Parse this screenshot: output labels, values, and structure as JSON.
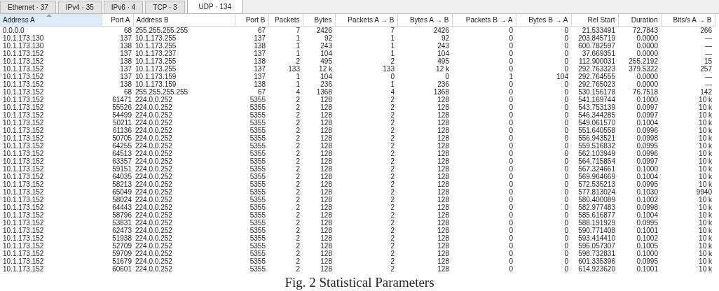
{
  "tabs": [
    {
      "label": "Ethernet · 37",
      "selected": false
    },
    {
      "label": "IPv4 · 35",
      "selected": false
    },
    {
      "label": "IPv6 · 4",
      "selected": false
    },
    {
      "label": "TCP · 3",
      "selected": false
    },
    {
      "label": "UDP · 134",
      "selected": true
    }
  ],
  "table": {
    "columns": [
      {
        "label": "Address A",
        "sorted": true
      },
      {
        "label": "Port A",
        "sorted": false
      },
      {
        "label": "Address B",
        "sorted": false
      },
      {
        "label": "Port B",
        "sorted": false
      },
      {
        "label": "Packets",
        "sorted": false
      },
      {
        "label": "Bytes",
        "sorted": false
      },
      {
        "label": "Packets A → B",
        "sorted": false
      },
      {
        "label": "Bytes A → B",
        "sorted": false
      },
      {
        "label": "Packets B → A",
        "sorted": false
      },
      {
        "label": "Bytes B → A",
        "sorted": false
      },
      {
        "label": "Rel Start",
        "sorted": false
      },
      {
        "label": "Duration",
        "sorted": false
      },
      {
        "label": "Bits/s A → B",
        "sorted": false
      }
    ],
    "rows": [
      [
        "0.0.0.0",
        "68",
        "255.255.255.255",
        "67",
        "7",
        "2426",
        "7",
        "2426",
        "0",
        "0",
        "21.533491",
        "72.7843",
        "266"
      ],
      [
        "10.1.173.130",
        "137",
        "10.1.173.255",
        "137",
        "1",
        "92",
        "1",
        "92",
        "0",
        "0",
        "203.845719",
        "0.0000",
        "—"
      ],
      [
        "10.1.173.130",
        "138",
        "10.1.173.255",
        "138",
        "1",
        "243",
        "1",
        "243",
        "0",
        "0",
        "600.782597",
        "0.0000",
        "—"
      ],
      [
        "10.1.173.152",
        "137",
        "10.1.173.237",
        "137",
        "1",
        "104",
        "1",
        "104",
        "0",
        "0",
        "37.669351",
        "0.0000",
        "—"
      ],
      [
        "10.1.173.152",
        "138",
        "10.1.173.255",
        "138",
        "2",
        "495",
        "2",
        "495",
        "0",
        "0",
        "112.900031",
        "255.2192",
        "15"
      ],
      [
        "10.1.173.152",
        "137",
        "10.1.173.255",
        "137",
        "133",
        "12 k",
        "133",
        "12 k",
        "0",
        "0",
        "292.763323",
        "379.5322",
        "257"
      ],
      [
        "10.1.173.152",
        "137",
        "10.1.173.159",
        "137",
        "1",
        "104",
        "0",
        "0",
        "1",
        "104",
        "292.764555",
        "0.0000",
        "—"
      ],
      [
        "10.1.173.152",
        "138",
        "10.1.173.159",
        "138",
        "1",
        "236",
        "1",
        "236",
        "0",
        "0",
        "292.765023",
        "0.0000",
        "—"
      ],
      [
        "10.1.173.152",
        "68",
        "255.255.255.255",
        "67",
        "4",
        "1368",
        "4",
        "1368",
        "0",
        "0",
        "530.156178",
        "76.7518",
        "142"
      ],
      [
        "10.1.173.152",
        "61471",
        "224.0.0.252",
        "5355",
        "2",
        "128",
        "2",
        "128",
        "0",
        "0",
        "541.169744",
        "0.1000",
        "10 k"
      ],
      [
        "10.1.173.152",
        "55526",
        "224.0.0.252",
        "5355",
        "2",
        "128",
        "2",
        "128",
        "0",
        "0",
        "543.753139",
        "0.0997",
        "10 k"
      ],
      [
        "10.1.173.152",
        "54499",
        "224.0.0.252",
        "5355",
        "2",
        "128",
        "2",
        "128",
        "0",
        "0",
        "546.344285",
        "0.0997",
        "10 k"
      ],
      [
        "10.1.173.152",
        "50211",
        "224.0.0.252",
        "5355",
        "2",
        "128",
        "2",
        "128",
        "0",
        "0",
        "549.061570",
        "0.1004",
        "10 k"
      ],
      [
        "10.1.173.152",
        "61136",
        "224.0.0.252",
        "5355",
        "2",
        "128",
        "2",
        "128",
        "0",
        "0",
        "551.640558",
        "0.0996",
        "10 k"
      ],
      [
        "10.1.173.152",
        "50705",
        "224.0.0.252",
        "5355",
        "2",
        "128",
        "2",
        "128",
        "0",
        "0",
        "556.943521",
        "0.0998",
        "10 k"
      ],
      [
        "10.1.173.152",
        "64255",
        "224.0.0.252",
        "5355",
        "2",
        "128",
        "2",
        "128",
        "0",
        "0",
        "559.516832",
        "0.0995",
        "10 k"
      ],
      [
        "10.1.173.152",
        "64513",
        "224.0.0.252",
        "5355",
        "2",
        "128",
        "2",
        "128",
        "0",
        "0",
        "562.103949",
        "0.0996",
        "10 k"
      ],
      [
        "10.1.173.152",
        "63357",
        "224.0.0.252",
        "5355",
        "2",
        "128",
        "2",
        "128",
        "0",
        "0",
        "564.715854",
        "0.0997",
        "10 k"
      ],
      [
        "10.1.173.152",
        "59151",
        "224.0.0.252",
        "5355",
        "2",
        "128",
        "2",
        "128",
        "0",
        "0",
        "567.324661",
        "0.1000",
        "10 k"
      ],
      [
        "10.1.173.152",
        "64035",
        "224.0.0.252",
        "5355",
        "2",
        "128",
        "2",
        "128",
        "0",
        "0",
        "569.964669",
        "0.1004",
        "10 k"
      ],
      [
        "10.1.173.152",
        "58213",
        "224.0.0.252",
        "5355",
        "2",
        "128",
        "2",
        "128",
        "0",
        "0",
        "572.535213",
        "0.0995",
        "10 k"
      ],
      [
        "10.1.173.152",
        "65049",
        "224.0.0.252",
        "5355",
        "2",
        "128",
        "2",
        "128",
        "0",
        "0",
        "577.813024",
        "0.1030",
        "9940"
      ],
      [
        "10.1.173.152",
        "58024",
        "224.0.0.252",
        "5355",
        "2",
        "128",
        "2",
        "128",
        "0",
        "0",
        "580.400089",
        "0.1002",
        "10 k"
      ],
      [
        "10.1.173.152",
        "64443",
        "224.0.0.252",
        "5355",
        "2",
        "128",
        "2",
        "128",
        "0",
        "0",
        "582.977483",
        "0.0998",
        "10 k"
      ],
      [
        "10.1.173.152",
        "58796",
        "224.0.0.252",
        "5355",
        "2",
        "128",
        "2",
        "128",
        "0",
        "0",
        "585.616877",
        "0.1004",
        "10 k"
      ],
      [
        "10.1.173.152",
        "53831",
        "224.0.0.252",
        "5355",
        "2",
        "128",
        "2",
        "128",
        "0",
        "0",
        "588.191929",
        "0.0995",
        "10 k"
      ],
      [
        "10.1.173.152",
        "62473",
        "224.0.0.252",
        "5355",
        "2",
        "128",
        "2",
        "128",
        "0",
        "0",
        "590.771408",
        "0.1001",
        "10 k"
      ],
      [
        "10.1.173.152",
        "51938",
        "224.0.0.252",
        "5355",
        "2",
        "128",
        "2",
        "128",
        "0",
        "0",
        "593.414410",
        "0.1002",
        "10 k"
      ],
      [
        "10.1.173.152",
        "52709",
        "224.0.0.252",
        "5355",
        "2",
        "128",
        "2",
        "128",
        "0",
        "0",
        "596.057307",
        "0.1005",
        "10 k"
      ],
      [
        "10.1.173.152",
        "59709",
        "224.0.0.252",
        "5355",
        "2",
        "128",
        "2",
        "128",
        "0",
        "0",
        "598.732831",
        "0.1000",
        "10 k"
      ],
      [
        "10.1.173.152",
        "51679",
        "224.0.0.252",
        "5355",
        "2",
        "128",
        "2",
        "128",
        "0",
        "0",
        "601.335396",
        "0.0995",
        "10 k"
      ],
      [
        "10.1.173.152",
        "60601",
        "224.0.0.252",
        "5355",
        "2",
        "128",
        "2",
        "128",
        "0",
        "0",
        "614.923620",
        "0.1001",
        "10 k"
      ]
    ]
  },
  "caption": "Fig. 2 Statistical Parameters"
}
